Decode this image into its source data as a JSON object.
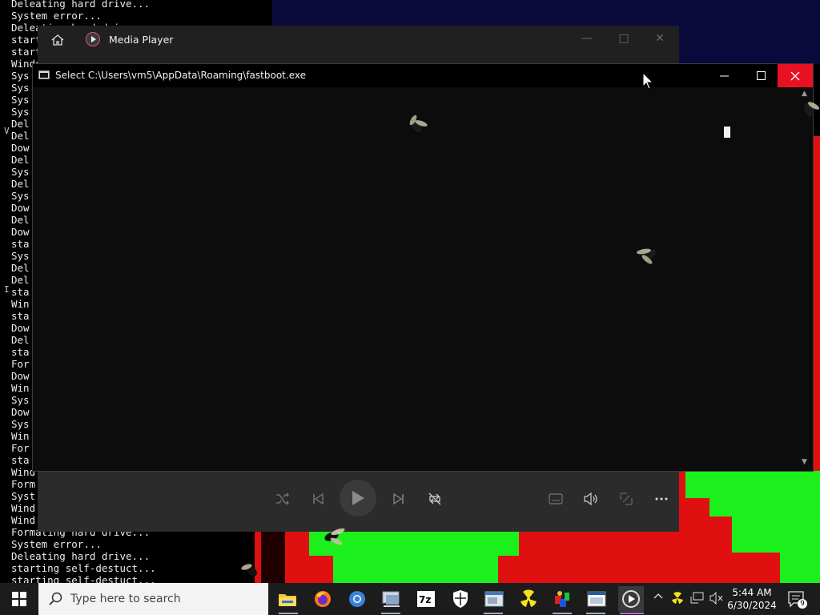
{
  "console": {
    "top_lines": [
      "Deleating hard drive...",
      "System error...",
      "Deleating hard drive...",
      "starting self-destuct...",
      "starting self-destuct...",
      "Windows is not responding...",
      "Sys",
      "Sys",
      "Sys",
      "Sys",
      "Del",
      "Del",
      "Dow",
      "Del",
      "Sys",
      "Del",
      "Sys",
      "Dow",
      "Del",
      "Dow",
      "sta",
      "Sys",
      "Del",
      "Del",
      "sta",
      "Win",
      "sta",
      "Dow",
      "Del",
      "sta",
      "For",
      "Dow",
      "Win",
      "Sys",
      "Dow",
      "Sys",
      "Win",
      "For",
      "sta",
      "Wind",
      "Form",
      "Syst",
      "Wind",
      "Wind"
    ],
    "bottom_lines": [
      "Formating hard drive...",
      "System error...",
      "Deleating hard drive...",
      "starting self-destuct...",
      "starting self-destuct..."
    ]
  },
  "media_player": {
    "title": "Media Player",
    "controls": {
      "shuffle": "shuffle-icon",
      "previous": "previous-icon",
      "play": "play-icon",
      "next": "next-icon",
      "repeat": "repeat-icon",
      "captions": "captions-icon",
      "volume": "volume-icon",
      "miniplayer": "miniplayer-icon",
      "more": "more-icon"
    }
  },
  "cmd_window": {
    "title": "Select C:\\Users\\vm5\\AppData\\Roaming\\fastboot.exe"
  },
  "taskbar": {
    "search_placeholder": "Type here to search",
    "time": "5:44 AM",
    "date": "6/30/2024",
    "notification_count": "9",
    "pinned": [
      "file-explorer-icon",
      "firefox-icon",
      "chrome-icon",
      "control-panel-icon",
      "7zip-icon",
      "windows-security-icon",
      "app-window-icon",
      "radiation-icon",
      "paint-app-icon",
      "media-window-icon",
      "media-player-icon"
    ]
  },
  "colors": {
    "close_red": "#e81123",
    "glitch_red": "#e01010",
    "glitch_green": "#1cf01c",
    "navy": "#0a0a3c"
  }
}
